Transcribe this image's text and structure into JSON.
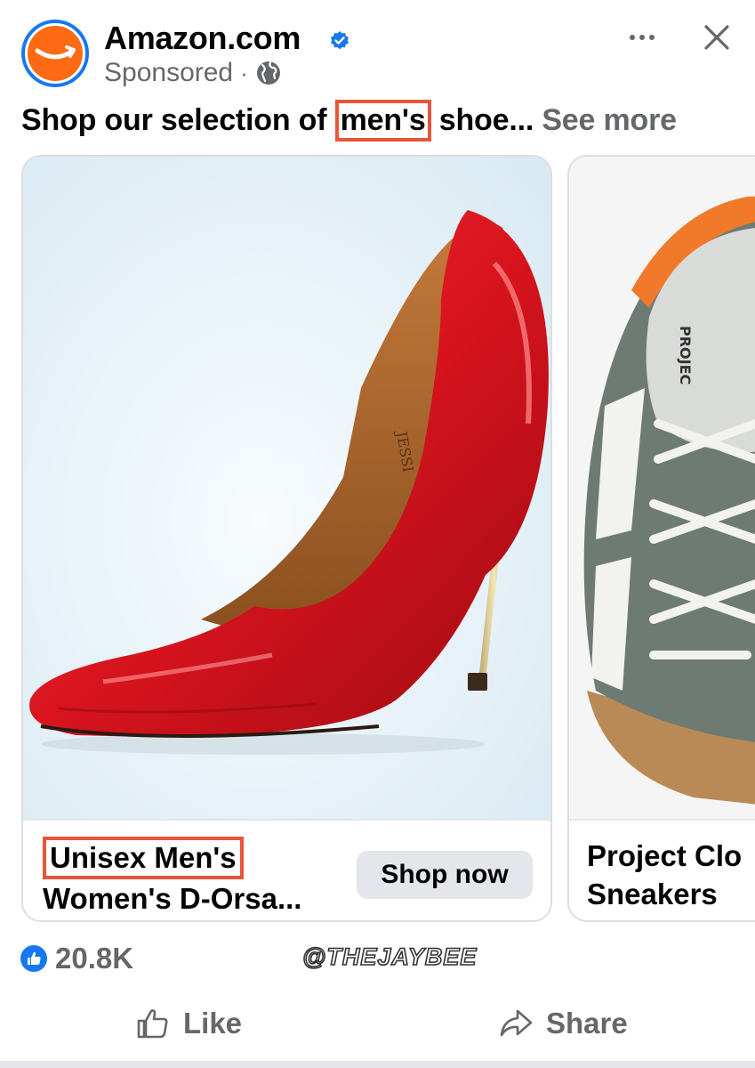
{
  "post": {
    "brand_name": "Amazon.com",
    "sponsored_label": "Sponsored",
    "meta_separator": "·",
    "audience_icon": "globe-icon",
    "caption": {
      "before": "Shop our selection of ",
      "highlight": "men's",
      "after": " shoe... ",
      "see_more": "See more"
    }
  },
  "cards": [
    {
      "title_line1": "Unisex Men's",
      "title_line2": "Women's D-Orsa...",
      "button_label": "Shop now",
      "image_text": "JESSI"
    },
    {
      "title_line1": "Project Clo",
      "title_line2": "Sneakers",
      "image_text": "PROJEC"
    }
  ],
  "engagement": {
    "reaction_count": "20.8K",
    "watermark": "@THEJAYBEE",
    "like_label": "Like",
    "share_label": "Share"
  },
  "colors": {
    "brand_orange": "#ff6a14",
    "facebook_blue": "#1877f2",
    "highlight_red": "#e8553a",
    "muted_text": "#65676b",
    "shoe_red": "#d9141e",
    "sneaker_gray": "#6e7b72"
  }
}
